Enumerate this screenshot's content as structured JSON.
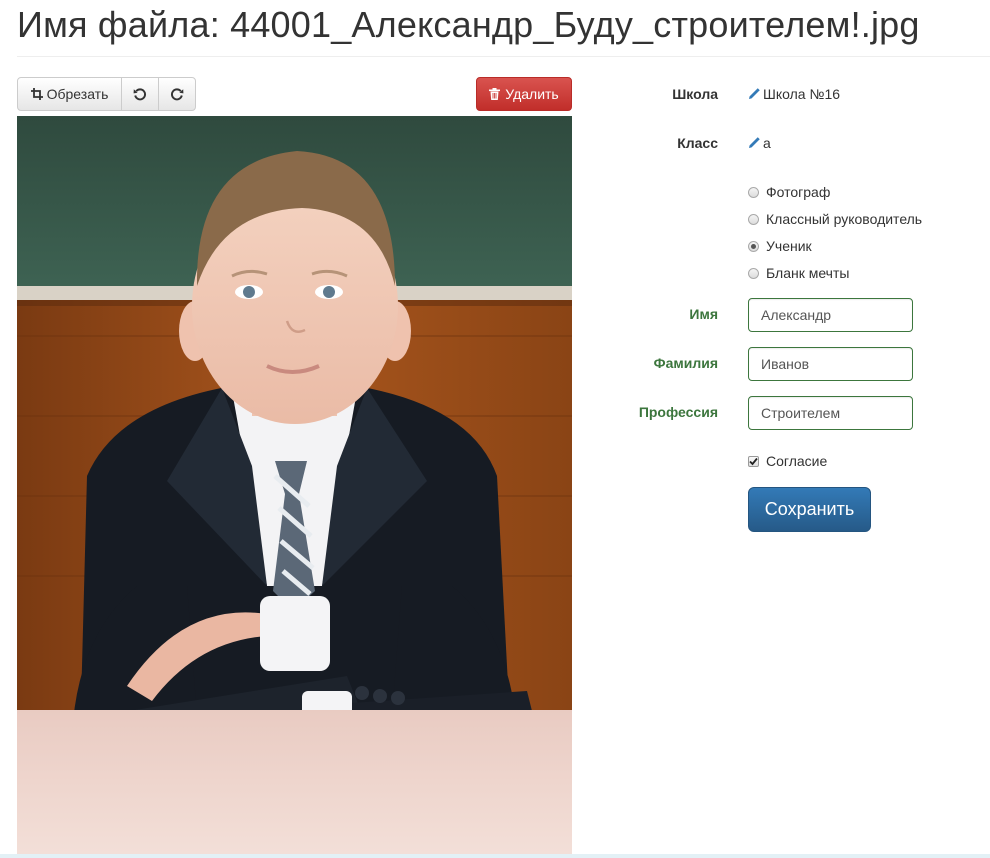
{
  "page": {
    "title": "Имя файла: 44001_Александр_Буду_строителем!.jpg"
  },
  "toolbar": {
    "crop_label": "Обрезать",
    "delete_label": "Удалить"
  },
  "form": {
    "school": {
      "label": "Школа",
      "value": "Школа №16"
    },
    "class": {
      "label": "Класс",
      "value": "а"
    },
    "roles": [
      {
        "label": "Фотограф",
        "checked": false
      },
      {
        "label": "Классный руководитель",
        "checked": false
      },
      {
        "label": "Ученик",
        "checked": true
      },
      {
        "label": "Бланк мечты",
        "checked": false
      }
    ],
    "first_name": {
      "label": "Имя",
      "value": "Александр"
    },
    "last_name": {
      "label": "Фамилия",
      "value": "Иванов"
    },
    "profession": {
      "label": "Профессия",
      "value": "Строителем"
    },
    "consent": {
      "label": "Согласие",
      "checked": true
    },
    "save_label": "Сохранить"
  },
  "colors": {
    "success": "#3c763d",
    "primary": "#337ab7",
    "danger": "#d9534f",
    "edit_icon": "#337ab7"
  },
  "icons": {
    "crop": "crop-icon",
    "rotate_left": "rotate-left-icon",
    "rotate_right": "rotate-right-icon",
    "delete": "trash-icon",
    "edit": "pencil-icon"
  }
}
